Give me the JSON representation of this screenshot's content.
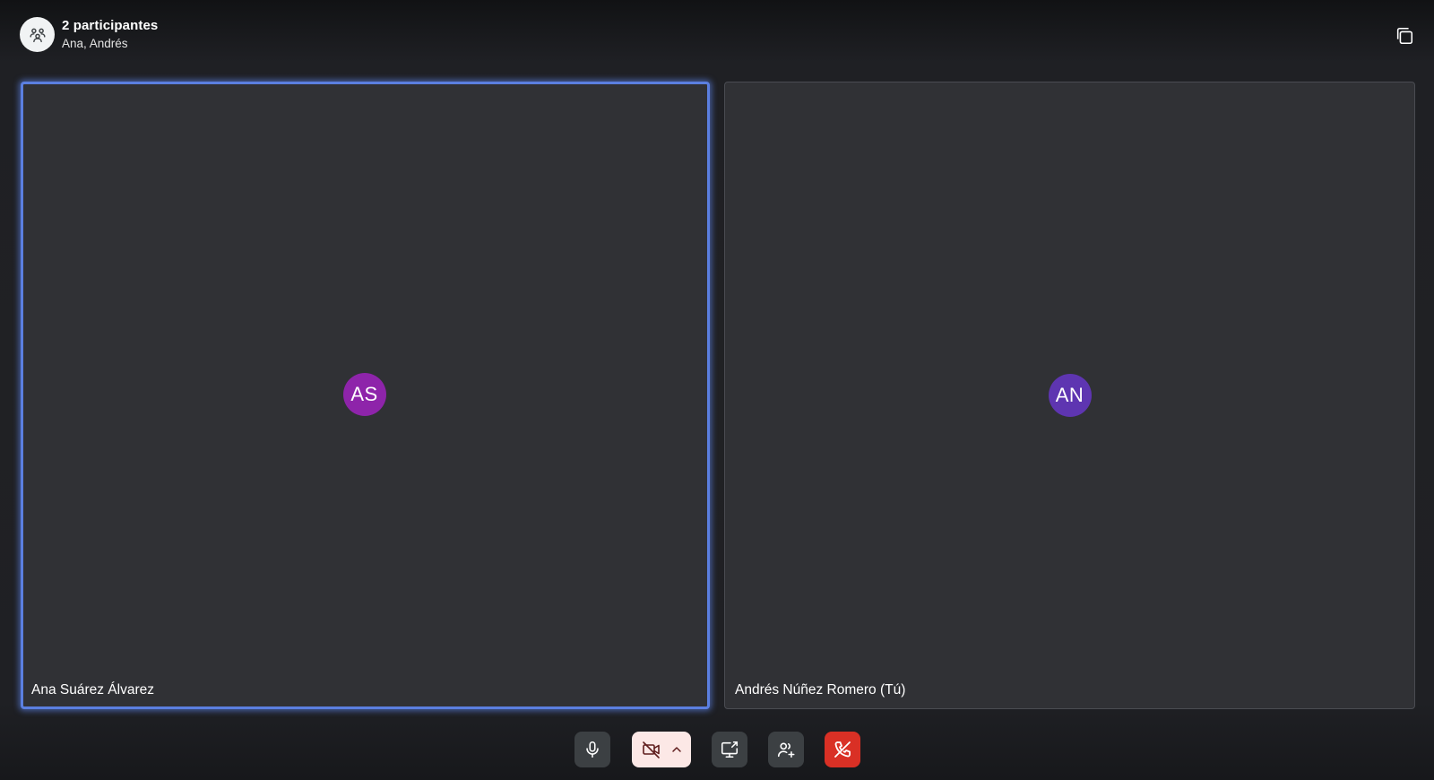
{
  "header": {
    "title": "2 participantes",
    "subtitle": "Ana, Andrés",
    "group_icon": "people-group-icon",
    "pip_icon": "picture-in-picture-icon"
  },
  "tiles": [
    {
      "initials": "AS",
      "name": "Ana Suárez Álvarez",
      "avatar_color": "#8e24aa",
      "speaking": true
    },
    {
      "initials": "AN",
      "name": "Andrés Núñez Romero (Tú)",
      "avatar_color": "#5e35b1",
      "speaking": false
    }
  ],
  "controls": {
    "mic_icon": "microphone-icon",
    "camera_icon": "video-off-icon",
    "camera_options_icon": "chevron-up-icon",
    "share_icon": "screen-share-icon",
    "add_people_icon": "add-person-icon",
    "hangup_icon": "hang-up-icon"
  },
  "colors": {
    "speaking_outline": "#5b7fe0",
    "hangup": "#d93025",
    "camera_off_bg": "#fce8e6",
    "control_bg": "#3c4043",
    "tile_bg": "#303135"
  }
}
